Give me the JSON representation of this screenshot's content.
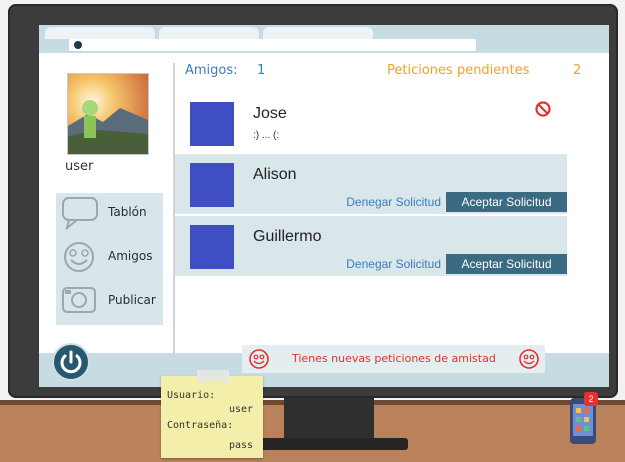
{
  "header": {
    "friends_label": "Amigos:",
    "friends_count": "1",
    "pending_label": "Peticiones pendientes",
    "pending_count": "2"
  },
  "profile": {
    "username": "user"
  },
  "menu": {
    "items": [
      {
        "label": "Tablón",
        "icon": "speech-bubble-icon"
      },
      {
        "label": "Amigos",
        "icon": "smiley-icon"
      },
      {
        "label": "Publicar",
        "icon": "camera-icon"
      }
    ]
  },
  "friends": [
    {
      "name": "Jose",
      "status": ":) ... (:"
    }
  ],
  "requests": [
    {
      "name": "Alison",
      "deny_label": "Denegar Solicitud",
      "accept_label": "Aceptar Solicitud"
    },
    {
      "name": "Guillermo",
      "deny_label": "Denegar Solicitud",
      "accept_label": "Aceptar Solicitud"
    }
  ],
  "notification": {
    "text": "Tienes nuevas peticiones de amistad"
  },
  "sticky_note": {
    "user_label": "Usuario:",
    "user_value": "user",
    "pass_label": "Contraseña:",
    "pass_value": "pass"
  },
  "phone": {
    "badge": "2"
  },
  "colors": {
    "accent_blue": "#3a7ebd",
    "pending_orange": "#f0a224",
    "accept_button": "#3a6b82",
    "alert_red": "#e33030",
    "avatar_square": "#3f4fc3"
  }
}
